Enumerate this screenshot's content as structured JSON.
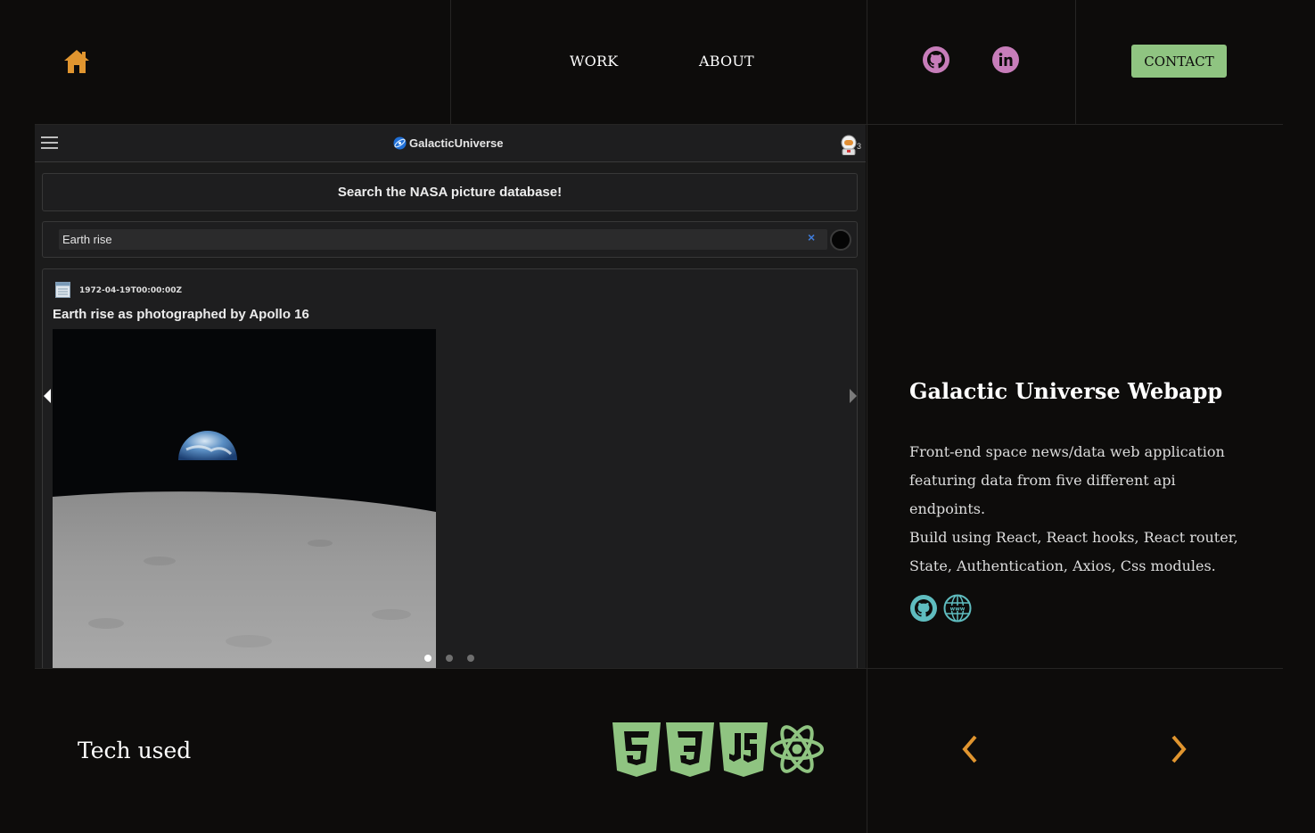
{
  "header": {
    "nav": [
      {
        "label": "WORK"
      },
      {
        "label": "ABOUT"
      }
    ],
    "contact_label": "CONTACT"
  },
  "embedded_app": {
    "app_name": "GalacticUniverse",
    "notification_count": "3",
    "search_heading": "Search the NASA picture database!",
    "search_value": "Earth rise",
    "clear_symbol": "×",
    "result": {
      "date": "1972-04-19T00:00:00Z",
      "title": "Earth rise as photographed by Apollo 16"
    },
    "carousel": {
      "slides": 3,
      "active_index": 0
    }
  },
  "project": {
    "title": "Galactic Universe Webapp",
    "description_1a": "Front-end space news/data web application",
    "description_1b": "featuring data from five different api endpoints.",
    "description_2a": "Build using React, React hooks, React router,",
    "description_2b": "State, Authentication, Axios, Css modules."
  },
  "footer": {
    "tech_label": "Tech used",
    "tech_icons": [
      "html5-icon",
      "css3-icon",
      "javascript-icon",
      "react-icon"
    ]
  },
  "colors": {
    "background": "#0d0c0b",
    "accent_orange": "#e0952f",
    "accent_green": "#8fc481",
    "social_pink": "#c77dba",
    "link_teal": "#5fbcbf"
  }
}
